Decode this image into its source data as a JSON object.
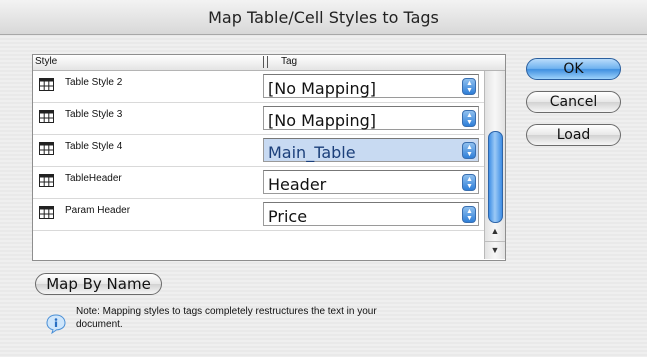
{
  "window": {
    "title": "Map Table/Cell Styles to Tags"
  },
  "table": {
    "columns": {
      "style": "Style",
      "tag": "Tag"
    },
    "rows": [
      {
        "style": "Table Style 2",
        "tag": "[No Mapping]",
        "selected": false
      },
      {
        "style": "Table Style 3",
        "tag": "[No Mapping]",
        "selected": false
      },
      {
        "style": "Table Style 4",
        "tag": "Main_Table",
        "selected": true
      },
      {
        "style": "TableHeader",
        "tag": "Header",
        "selected": false
      },
      {
        "style": "Param Header",
        "tag": "Price",
        "selected": false
      }
    ]
  },
  "buttons": {
    "ok": "OK",
    "cancel": "Cancel",
    "load": "Load",
    "map_by_name": "Map By Name"
  },
  "note": "Note: Mapping styles to tags completely restructures the text in your document.",
  "icons": {
    "row": "table-grid-icon",
    "select": "up-down-arrows-icon",
    "note": "info-icon"
  },
  "colors": {
    "accent": "#3f8fe0",
    "selection": "#c8daf2"
  }
}
